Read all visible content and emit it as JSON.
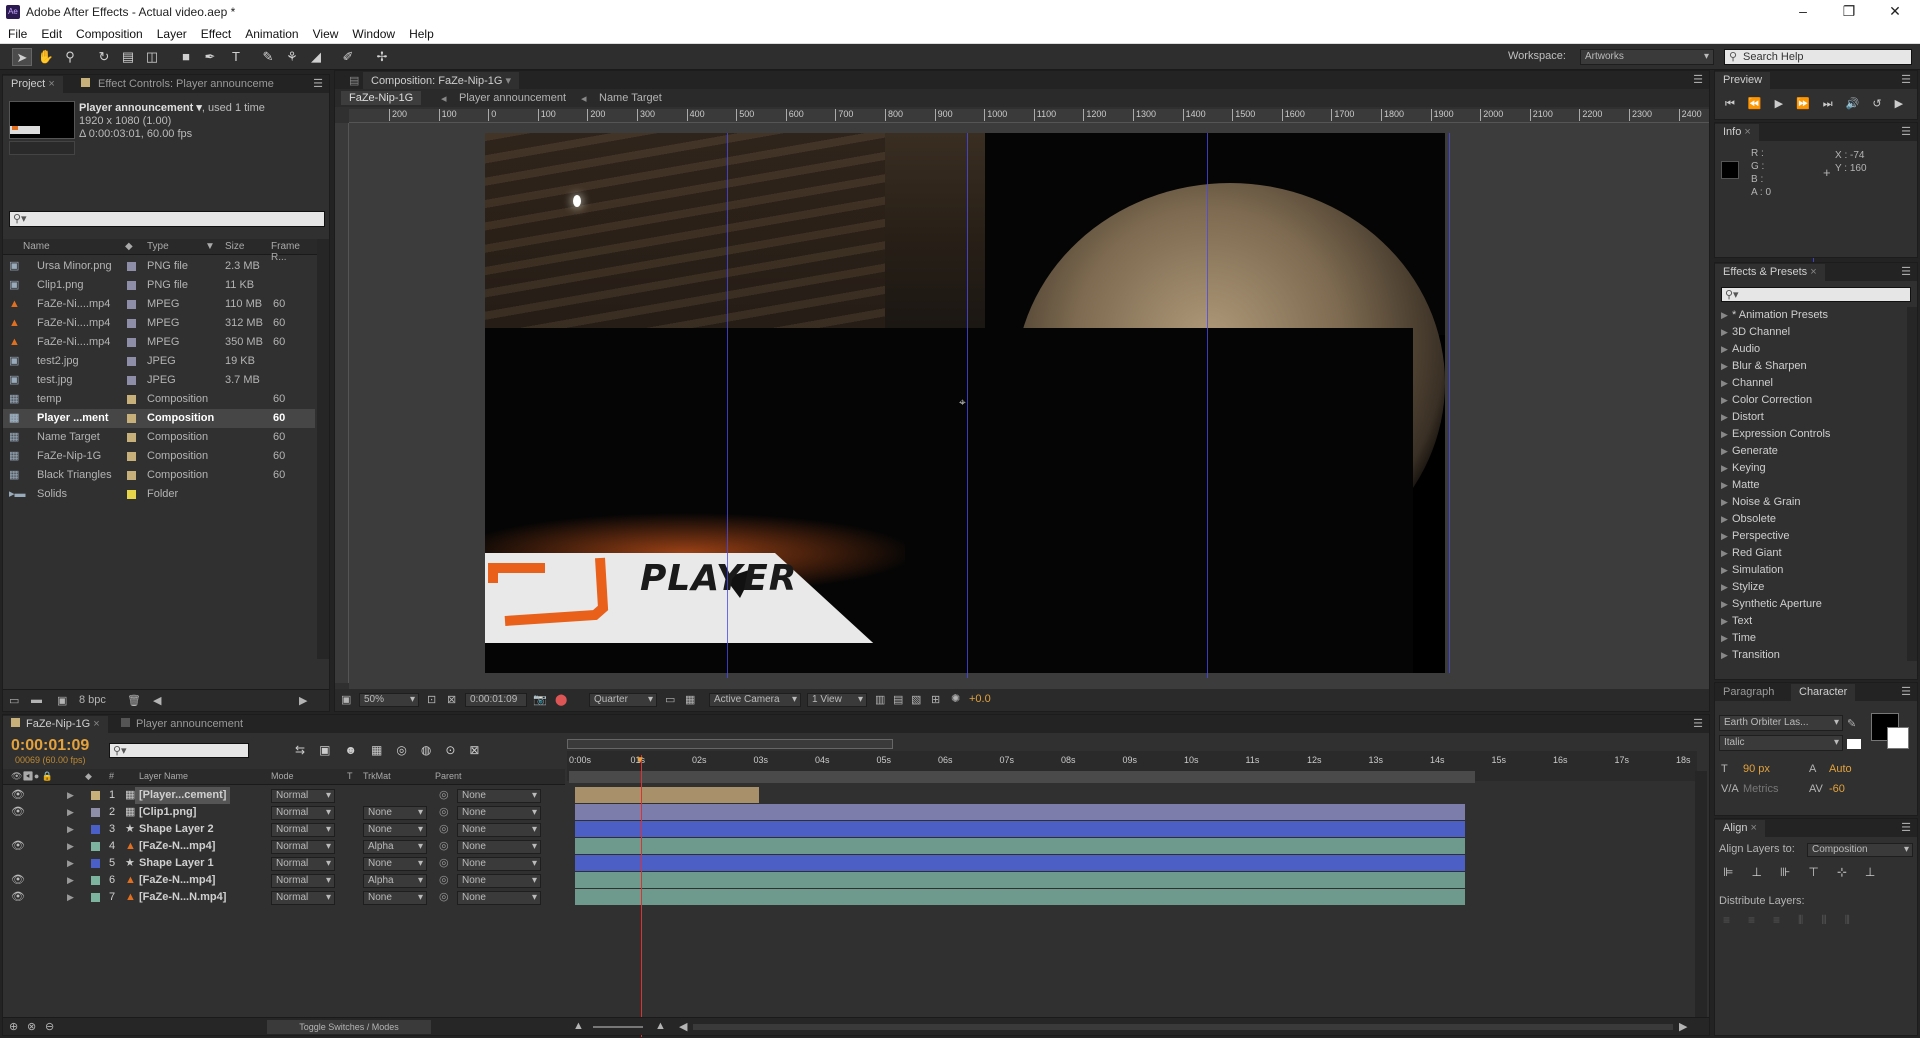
{
  "window": {
    "title": "Adobe After Effects - Actual video.aep *",
    "app_icon": "Ae"
  },
  "menu": [
    "File",
    "Edit",
    "Composition",
    "Layer",
    "Effect",
    "Animation",
    "View",
    "Window",
    "Help"
  ],
  "toolbar": {
    "workspace_label": "Workspace:",
    "workspace_value": "Artworks",
    "search_help_placeholder": "Search Help"
  },
  "project": {
    "tab_project": "Project",
    "tab_effect": "Effect Controls: Player announceme",
    "selected_name": "Player announcement",
    "used": ", used 1 time",
    "dimensions": "1920 x 1080 (1.00)",
    "duration": "Δ 0:00:03:01, 60.00 fps",
    "columns": [
      "Name",
      "Type",
      "Size",
      "Frame R..."
    ],
    "items": [
      {
        "name": "Ursa Minor.png",
        "type": "PNG file",
        "size": "2.3 MB",
        "fps": "",
        "color": "#8e8ea8",
        "icon": "image-icon"
      },
      {
        "name": "Clip1.png",
        "type": "PNG file",
        "size": "11 KB",
        "fps": "",
        "color": "#8e8ea8",
        "icon": "image-icon"
      },
      {
        "name": "FaZe-Ni....mp4",
        "type": "MPEG",
        "size": "110 MB",
        "fps": "60",
        "color": "#8e8ea8",
        "icon": "video-icon"
      },
      {
        "name": "FaZe-Ni....mp4",
        "type": "MPEG",
        "size": "312 MB",
        "fps": "60",
        "color": "#8e8ea8",
        "icon": "video-icon"
      },
      {
        "name": "FaZe-Ni....mp4",
        "type": "MPEG",
        "size": "350 MB",
        "fps": "60",
        "color": "#8e8ea8",
        "icon": "video-icon"
      },
      {
        "name": "test2.jpg",
        "type": "JPEG",
        "size": "19 KB",
        "fps": "",
        "color": "#8e8ea8",
        "icon": "image-icon"
      },
      {
        "name": "test.jpg",
        "type": "JPEG",
        "size": "3.7 MB",
        "fps": "",
        "color": "#8e8ea8",
        "icon": "image-icon"
      },
      {
        "name": "temp",
        "type": "Composition",
        "size": "",
        "fps": "60",
        "color": "#c8b07a",
        "icon": "composition-icon"
      },
      {
        "name": "Player ...ment",
        "type": "Composition",
        "size": "",
        "fps": "60",
        "color": "#c8b07a",
        "icon": "composition-icon"
      },
      {
        "name": "Name Target",
        "type": "Composition",
        "size": "",
        "fps": "60",
        "color": "#c8b07a",
        "icon": "composition-icon"
      },
      {
        "name": "FaZe-Nip-1G",
        "type": "Composition",
        "size": "",
        "fps": "60",
        "color": "#c8b07a",
        "icon": "composition-icon"
      },
      {
        "name": "Black Triangles",
        "type": "Composition",
        "size": "",
        "fps": "60",
        "color": "#c8b07a",
        "icon": "composition-icon"
      },
      {
        "name": "Solids",
        "type": "Folder",
        "size": "",
        "fps": "",
        "color": "#e6d44a",
        "icon": "folder-icon"
      }
    ],
    "bpc": "8 bpc"
  },
  "composition": {
    "tab": "Composition: FaZe-Nip-1G",
    "breadcrumbs": [
      "FaZe-Nip-1G",
      "Player announcement",
      "Name Target"
    ],
    "ruler": [
      "200",
      "100",
      "0",
      "100",
      "200",
      "300",
      "400",
      "500",
      "600",
      "700",
      "800",
      "900",
      "1000",
      "1100",
      "1200",
      "1300",
      "1400",
      "1500",
      "1600",
      "1700",
      "1800",
      "1900",
      "2000",
      "2100",
      "2200",
      "2300",
      "2400"
    ],
    "overlay_text": "PLAYER",
    "footer": {
      "zoom": "50%",
      "timecode": "0:00:01:09",
      "resolution": "Quarter",
      "camera": "Active Camera",
      "views": "1 View",
      "exposure": "+0.0"
    }
  },
  "preview": {
    "tab": "Preview"
  },
  "info": {
    "tab": "Info",
    "r": "R :",
    "g": "G :",
    "b": "B :",
    "a": "A : 0",
    "x": "X : -74",
    "y": "Y : 160"
  },
  "effects": {
    "tab": "Effects & Presets",
    "items": [
      "* Animation Presets",
      "3D Channel",
      "Audio",
      "Blur & Sharpen",
      "Channel",
      "Color Correction",
      "Distort",
      "Expression Controls",
      "Generate",
      "Keying",
      "Matte",
      "Noise & Grain",
      "Obsolete",
      "Perspective",
      "Red Giant",
      "Simulation",
      "Stylize",
      "Synthetic Aperture",
      "Text",
      "Time",
      "Transition"
    ]
  },
  "character": {
    "tab_paragraph": "Paragraph",
    "tab_character": "Character",
    "font": "Earth Orbiter Las...",
    "style": "Italic",
    "size": "90 px",
    "leading": "Auto",
    "kerning": "Metrics",
    "tracking": "-60"
  },
  "align": {
    "tab": "Align",
    "align_to_label": "Align Layers to:",
    "align_to_value": "Composition",
    "distribute_label": "Distribute Layers:"
  },
  "timeline": {
    "tab_active": "FaZe-Nip-1G",
    "tab_other": "Player announcement",
    "timecode": "0:00:01:09",
    "frames": "00069 (60.00 fps)",
    "columns": {
      "num": "#",
      "name": "Layer Name",
      "mode": "Mode",
      "t": "T",
      "trkmat": "TrkMat",
      "parent": "Parent"
    },
    "ticks": [
      "0:00s",
      "01s",
      "02s",
      "03s",
      "04s",
      "05s",
      "06s",
      "07s",
      "08s",
      "09s",
      "10s",
      "11s",
      "12s",
      "13s",
      "14s",
      "15s",
      "16s",
      "17s",
      "18s"
    ],
    "layers": [
      {
        "num": "1",
        "name": "[Player...cement]",
        "mode": "Normal",
        "trkmat": "",
        "parent": "None",
        "color": "#c8b07a",
        "bar": "#a8906a"
      },
      {
        "num": "2",
        "name": "[Clip1.png]",
        "mode": "Normal",
        "trkmat": "None",
        "parent": "None",
        "color": "#8e8ea8",
        "bar": "#7d7dab"
      },
      {
        "num": "3",
        "name": "Shape Layer 2",
        "mode": "Normal",
        "trkmat": "None",
        "parent": "None",
        "color": "#4a60c8",
        "bar": "#4c5fc4"
      },
      {
        "num": "4",
        "name": "[FaZe-N...mp4]",
        "mode": "Normal",
        "trkmat": "Alpha",
        "parent": "None",
        "color": "#7db4a0",
        "bar": "#6e9a8e"
      },
      {
        "num": "5",
        "name": "Shape Layer 1",
        "mode": "Normal",
        "trkmat": "None",
        "parent": "None",
        "color": "#4a60c8",
        "bar": "#4c5fc4"
      },
      {
        "num": "6",
        "name": "[FaZe-N...mp4]",
        "mode": "Normal",
        "trkmat": "Alpha",
        "parent": "None",
        "color": "#7db4a0",
        "bar": "#6e9a8e"
      },
      {
        "num": "7",
        "name": "[FaZe-N...N.mp4]",
        "mode": "Normal",
        "trkmat": "None",
        "parent": "None",
        "color": "#7db4a0",
        "bar": "#6e9a8e"
      }
    ],
    "toggle_label": "Toggle Switches / Modes"
  }
}
